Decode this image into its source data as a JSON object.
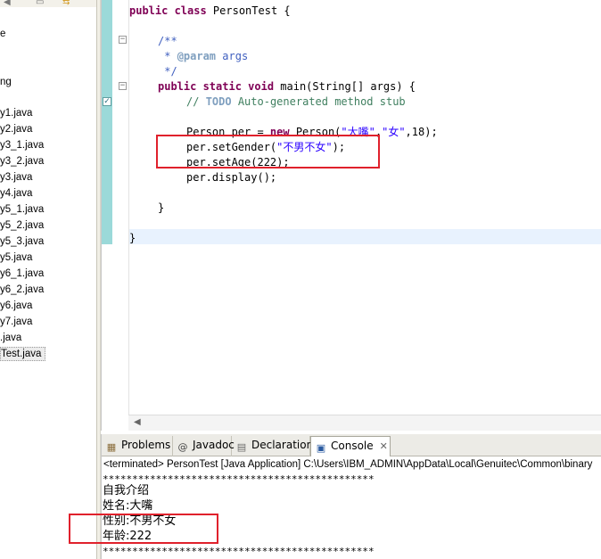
{
  "explorer": {
    "items": [
      {
        "label": "e"
      },
      {
        "label": "ng"
      },
      {
        "label": "y1.java"
      },
      {
        "label": "y2.java"
      },
      {
        "label": "y3_1.java"
      },
      {
        "label": "y3_2.java"
      },
      {
        "label": "y3.java"
      },
      {
        "label": "y4.java"
      },
      {
        "label": "y5_1.java"
      },
      {
        "label": "y5_2.java"
      },
      {
        "label": "y5_3.java"
      },
      {
        "label": "y5.java"
      },
      {
        "label": "y6_1.java"
      },
      {
        "label": "y6_2.java"
      },
      {
        "label": "y6.java"
      },
      {
        "label": "y7.java"
      },
      {
        "label": ".java"
      },
      {
        "label": "Test.java",
        "selected": true
      }
    ]
  },
  "editor": {
    "class_decl_kw": "public class",
    "class_decl_name": " PersonTest {",
    "javadoc_open": "/**",
    "javadoc_param_prefix": " * ",
    "javadoc_param_tag": "@param",
    "javadoc_param_text": " args",
    "javadoc_close": " */",
    "main_kw": "public static void",
    "main_sig": " main(String[] args) {",
    "todo_prefix": "// ",
    "todo_tag": "TODO",
    "todo_text": " Auto-generated method stub",
    "person_decl_start": "Person per = ",
    "person_decl_new": "new",
    "person_decl_mid": " Person(",
    "person_arg_name": "\"大嘴\"",
    "person_comma": ",",
    "person_arg_gender": "\"女\"",
    "person_decl_end": ",18);",
    "set_gender_start": "per.setGender(",
    "set_gender_arg": "\"不男不女\"",
    "set_gender_end": ");",
    "set_age": "per.setAge(222);",
    "display": "per.display();",
    "close_method": "}",
    "close_class": "}"
  },
  "views": {
    "tabs": [
      {
        "label": "Problems",
        "icon": "problems-icon"
      },
      {
        "label": "Javadoc",
        "icon": "javadoc-icon"
      },
      {
        "label": "Declaration",
        "icon": "declaration-icon"
      },
      {
        "label": "Console",
        "icon": "console-icon",
        "active": true
      }
    ],
    "console": {
      "status": "<terminated> PersonTest [Java Application] C:\\Users\\IBM_ADMIN\\AppData\\Local\\Genuitec\\Common\\binary",
      "separator": "**********************************************",
      "lines": [
        "自我介绍",
        "姓名:大嘴",
        "性别:不男不女",
        "年龄:222"
      ]
    }
  },
  "colors": {
    "keyword": "#7f0055",
    "comment": "#3f5fbf",
    "string": "#2a00ff",
    "annotation_box": "#e0212c"
  }
}
